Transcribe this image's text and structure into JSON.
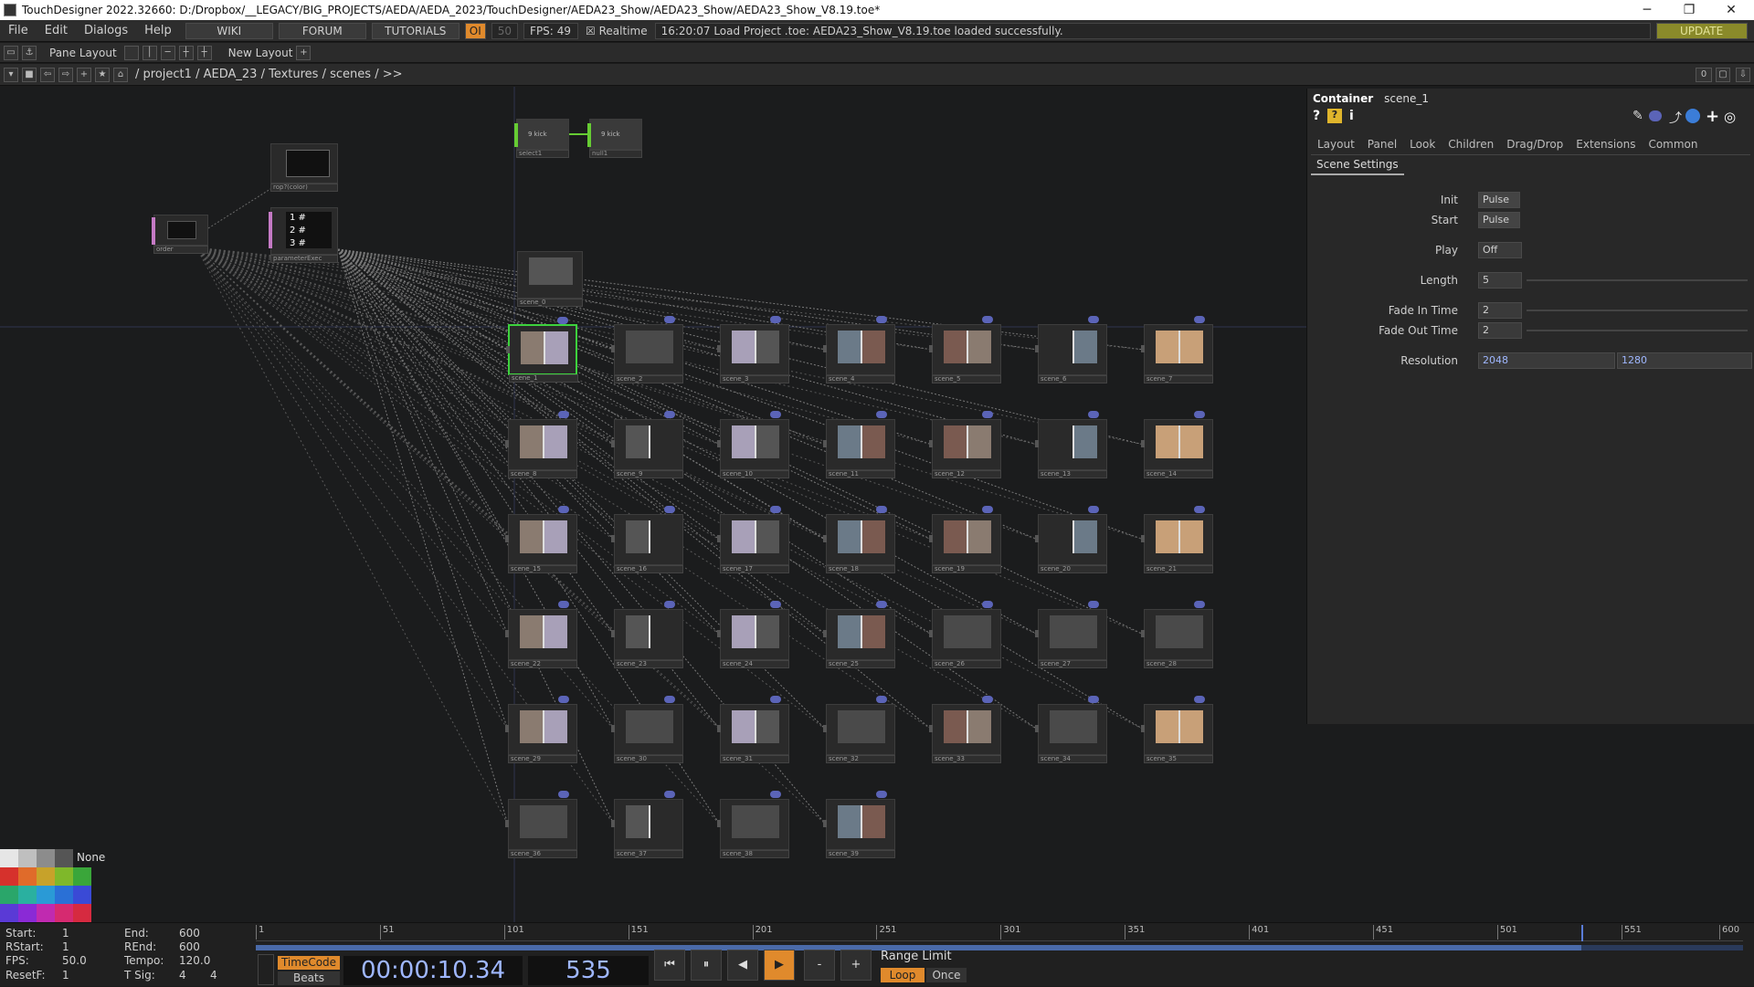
{
  "window": {
    "title": "TouchDesigner 2022.32660: D:/Dropbox/__LEGACY/BIG_PROJECTS/AEDA/AEDA_2023/TouchDesigner/AEDA23_Show/AEDA23_Show/AEDA23_Show_V8.19.toe*"
  },
  "menubar": {
    "menus": [
      "File",
      "Edit",
      "Dialogs",
      "Help"
    ],
    "wiki": "WIKI",
    "forum": "FORUM",
    "tutorials": "TUTORIALS",
    "oi": "OI",
    "fps_target": "50",
    "fps_label": "FPS:",
    "fps_value": "49",
    "realtime": "Realtime",
    "status": "16:20:07 Load Project .toe: AEDA23_Show_V8.19.toe loaded successfully.",
    "update": "UPDATE"
  },
  "toolbar": {
    "pane_layout": "Pane Layout",
    "new_layout": "New Layout"
  },
  "path": {
    "crumbs": [
      "/",
      "project1",
      "/",
      "AEDA_23",
      "/",
      "Textures",
      "/",
      "scenes",
      "/",
      ">>"
    ],
    "right_value": "0"
  },
  "nodes": {
    "top_a": "9 kick",
    "top_b": "9 kick",
    "top_a_lbl": "select1",
    "top_b_lbl": "null1",
    "rop": "rop?(color)",
    "table_lbl": "parameterExec",
    "ordr": "order",
    "scene0": "scene_0",
    "table_lines": [
      "1 #",
      "2 #",
      "3 #"
    ]
  },
  "scenes": [
    "scene_1",
    "scene_2",
    "scene_3",
    "scene_4",
    "scene_5",
    "scene_6",
    "scene_7",
    "scene_8",
    "scene_9",
    "scene_10",
    "scene_11",
    "scene_12",
    "scene_13",
    "scene_14",
    "scene_15",
    "scene_16",
    "scene_17",
    "scene_18",
    "scene_19",
    "scene_20",
    "scene_21",
    "scene_22",
    "scene_23",
    "scene_24",
    "scene_25",
    "scene_26",
    "scene_27",
    "scene_28",
    "scene_29",
    "scene_30",
    "scene_31",
    "scene_32",
    "scene_33",
    "scene_34",
    "scene_35",
    "scene_36",
    "scene_37",
    "scene_38",
    "scene_39"
  ],
  "param": {
    "type": "Container",
    "name": "scene_1",
    "tabs": [
      "Layout",
      "Panel",
      "Look",
      "Children",
      "Drag/Drop",
      "Extensions",
      "Common"
    ],
    "page": "Scene Settings",
    "init_label": "Init",
    "init_value": "Pulse",
    "start_label": "Start",
    "start_value": "Pulse",
    "play_label": "Play",
    "play_value": "Off",
    "length_label": "Length",
    "length_value": "5",
    "fadein_label": "Fade In Time",
    "fadein_value": "2",
    "fadeout_label": "Fade Out Time",
    "fadeout_value": "2",
    "res_label": "Resolution",
    "res_w": "2048",
    "res_h": "1280"
  },
  "palette": {
    "none_label": "None"
  },
  "timeline": {
    "start_label": "Start:",
    "start": "1",
    "end_label": "End:",
    "end": "600",
    "rstart_label": "RStart:",
    "rstart": "1",
    "rend_label": "REnd:",
    "rend": "600",
    "fps_label": "FPS:",
    "fps": "50.0",
    "tempo_label": "Tempo:",
    "tempo": "120.0",
    "resetf_label": "ResetF:",
    "resetf": "1",
    "tsig_label": "T Sig:",
    "tsig_a": "4",
    "tsig_b": "4",
    "timecode_label": "TimeCode",
    "beats_label": "Beats",
    "timecode": "00:00:10.34",
    "frame": "535",
    "range_limit": "Range Limit",
    "loop": "Loop",
    "once": "Once",
    "ruler": [
      "1",
      "51",
      "101",
      "151",
      "201",
      "251",
      "301",
      "351",
      "401",
      "451",
      "501",
      "551",
      "600"
    ],
    "progress": 535
  },
  "colors": {
    "accent": "#e08a2c",
    "select_green": "#3dd23d",
    "bubble": "#5b64b8",
    "timecode_blue": "#9fb7ff"
  }
}
